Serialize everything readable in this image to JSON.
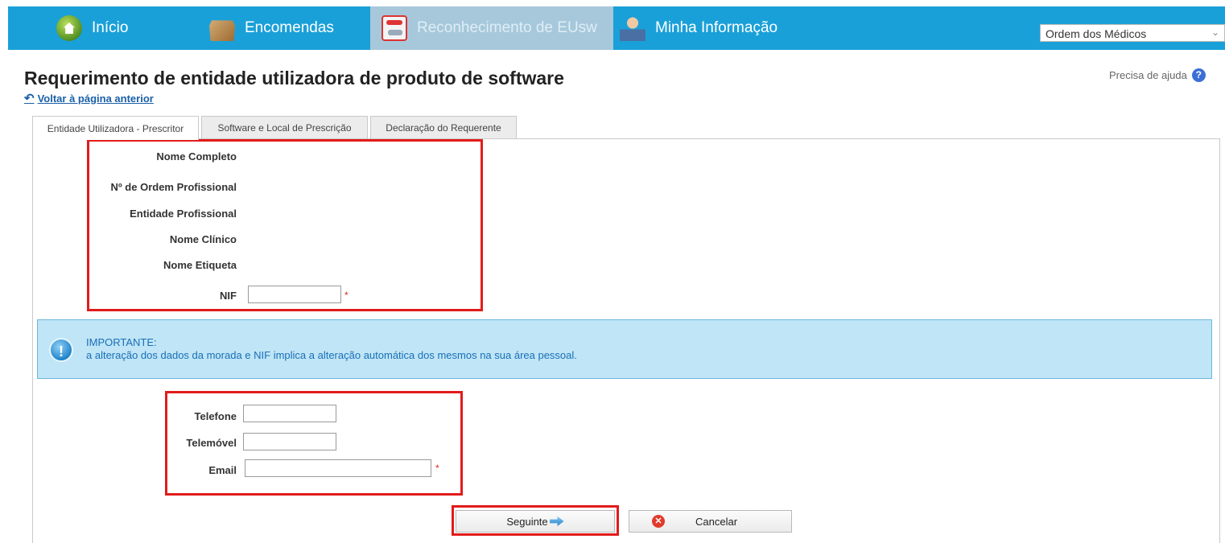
{
  "nav": {
    "items": [
      {
        "label": "Início",
        "icon": "home-icon"
      },
      {
        "label": "Encomendas",
        "icon": "package-icon"
      },
      {
        "label": "Reconhecimento de EUsw",
        "icon": "pills-icon"
      },
      {
        "label": "Minha Informação",
        "icon": "doctor-icon"
      }
    ],
    "org_select": {
      "value": "Ordem dos Médicos"
    },
    "bar_color": "#1aa0d8"
  },
  "header": {
    "title": "Requerimento de entidade utilizadora de produto de software",
    "back_link": "Voltar à página anterior",
    "help": "Precisa de ajuda"
  },
  "tabs": [
    {
      "label": "Entidade Utilizadora - Prescritor",
      "active": true
    },
    {
      "label": "Software e Local de Prescrição",
      "active": false
    },
    {
      "label": "Declaração do Requerente",
      "active": false
    }
  ],
  "entity_form": {
    "nome_completo": "Nome Completo",
    "ordem_profissional": "Nº de Ordem Profissional",
    "entidade_profissional": "Entidade Profissional",
    "nome_clinico": "Nome Clínico",
    "nome_etiqueta": "Nome Etiqueta",
    "nif": {
      "label": "NIF",
      "value": ""
    },
    "required_marker": "*"
  },
  "notice": {
    "title": "IMPORTANTE:",
    "text": "a alteração dos dados da morada e NIF implica a alteração automática dos mesmos na sua área pessoal."
  },
  "contact_form": {
    "telefone": {
      "label": "Telefone",
      "value": ""
    },
    "telemovel": {
      "label": "Telemóvel",
      "value": ""
    },
    "email": {
      "label": "Email",
      "value": ""
    }
  },
  "buttons": {
    "next": "Seguinte",
    "cancel": "Cancelar"
  },
  "highlight_color": "#e21b1b"
}
